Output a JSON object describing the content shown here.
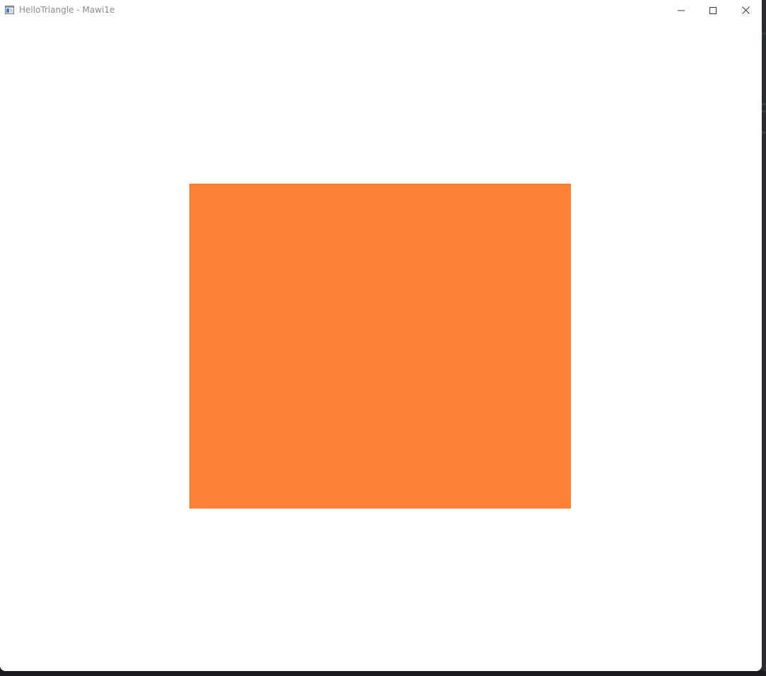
{
  "window": {
    "title": "HelloTriangle - Mawi1e",
    "controls": {
      "minimize_icon": "minimize-icon",
      "maximize_icon": "maximize-icon",
      "close_icon": "close-icon"
    }
  },
  "viewport": {
    "background_color": "#ffffff",
    "shape_color": "#fe8033"
  }
}
